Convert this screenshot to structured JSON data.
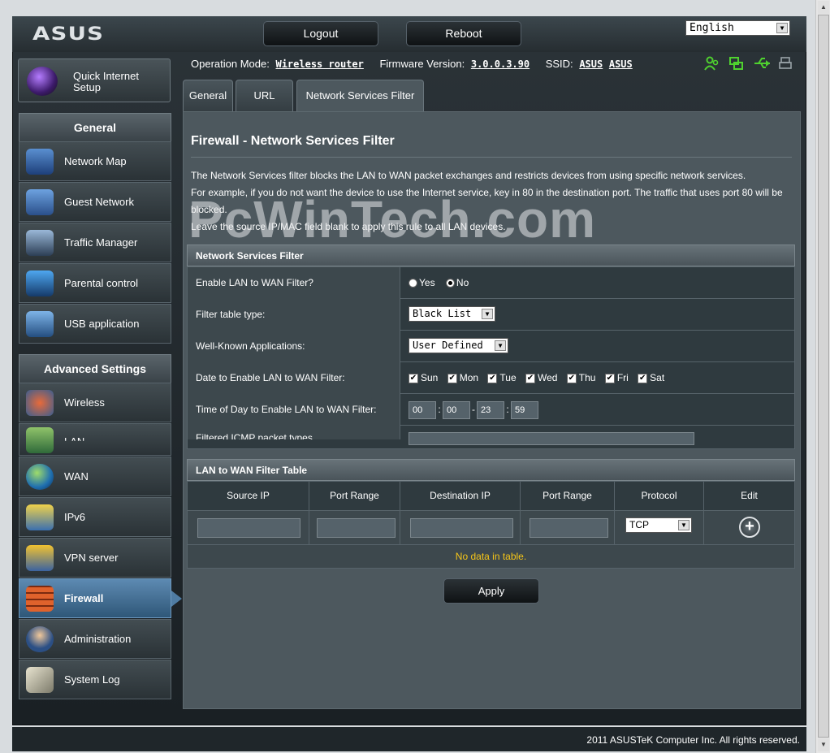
{
  "header": {
    "logo": "ASUS",
    "logout_label": "Logout",
    "reboot_label": "Reboot",
    "language": "English"
  },
  "status": {
    "op_mode_label": "Operation Mode:",
    "op_mode_value": "Wireless router",
    "fw_label": "Firmware Version:",
    "fw_value": "3.0.0.3.90",
    "ssid_label": "SSID:",
    "ssid_1": "ASUS",
    "ssid_2": "ASUS",
    "icon_color": "#4fd12f"
  },
  "sidebar": {
    "qis_label": "Quick Internet Setup",
    "general_head": "General",
    "general_items": [
      {
        "label": "Network Map"
      },
      {
        "label": "Guest Network"
      },
      {
        "label": "Traffic Manager"
      },
      {
        "label": "Parental control"
      },
      {
        "label": "USB application"
      }
    ],
    "advanced_head": "Advanced Settings",
    "advanced_items": [
      {
        "label": "Wireless"
      },
      {
        "label": "LAN"
      },
      {
        "label": "WAN"
      },
      {
        "label": "IPv6"
      },
      {
        "label": "VPN server"
      },
      {
        "label": "Firewall"
      },
      {
        "label": "Administration"
      },
      {
        "label": "System Log"
      }
    ]
  },
  "tabs": [
    {
      "label": "General"
    },
    {
      "label": "URL Filter"
    },
    {
      "label": "Network Services Filter"
    }
  ],
  "page": {
    "title": "Firewall - Network Services Filter",
    "desc_1": "The Network Services filter blocks the LAN to WAN packet exchanges and restricts devices from using specific network services.",
    "desc_2": "For example, if you do not want the device to use the Internet service, key in 80 in the destination port. The traffic that uses port 80 will be",
    "desc_3": "blocked.",
    "desc_4": "Leave the source IP/MAC field blank to apply this rule to all LAN devices.",
    "watermark": "PcWinTech.com"
  },
  "filter": {
    "section_title": "Network Services Filter",
    "enable_label": "Enable LAN to WAN Filter?",
    "yes_label": "Yes",
    "no_label": "No",
    "type_label": "Filter table type:",
    "type_value": "Black List",
    "apps_label": "Well-Known Applications:",
    "apps_value": "User Defined",
    "days_label": "Date to Enable LAN to WAN Filter:",
    "days": [
      "Sun",
      "Mon",
      "Tue",
      "Wed",
      "Thu",
      "Fri",
      "Sat"
    ],
    "time_label": "Time of Day to Enable LAN to WAN Filter:",
    "time": {
      "h1": "00",
      "m1": "00",
      "h2": "23",
      "m2": "59"
    },
    "partial_label": "Filtered ICMP packet types"
  },
  "lanwan": {
    "section_title": "LAN to WAN Filter Table",
    "columns": [
      "Source IP",
      "Port Range",
      "Destination IP",
      "Port Range",
      "Protocol",
      "Edit"
    ],
    "protocol": "TCP",
    "no_data": "No data in table."
  },
  "apply_label": "Apply",
  "footer": "2011 ASUSTeK Computer Inc. All rights reserved."
}
